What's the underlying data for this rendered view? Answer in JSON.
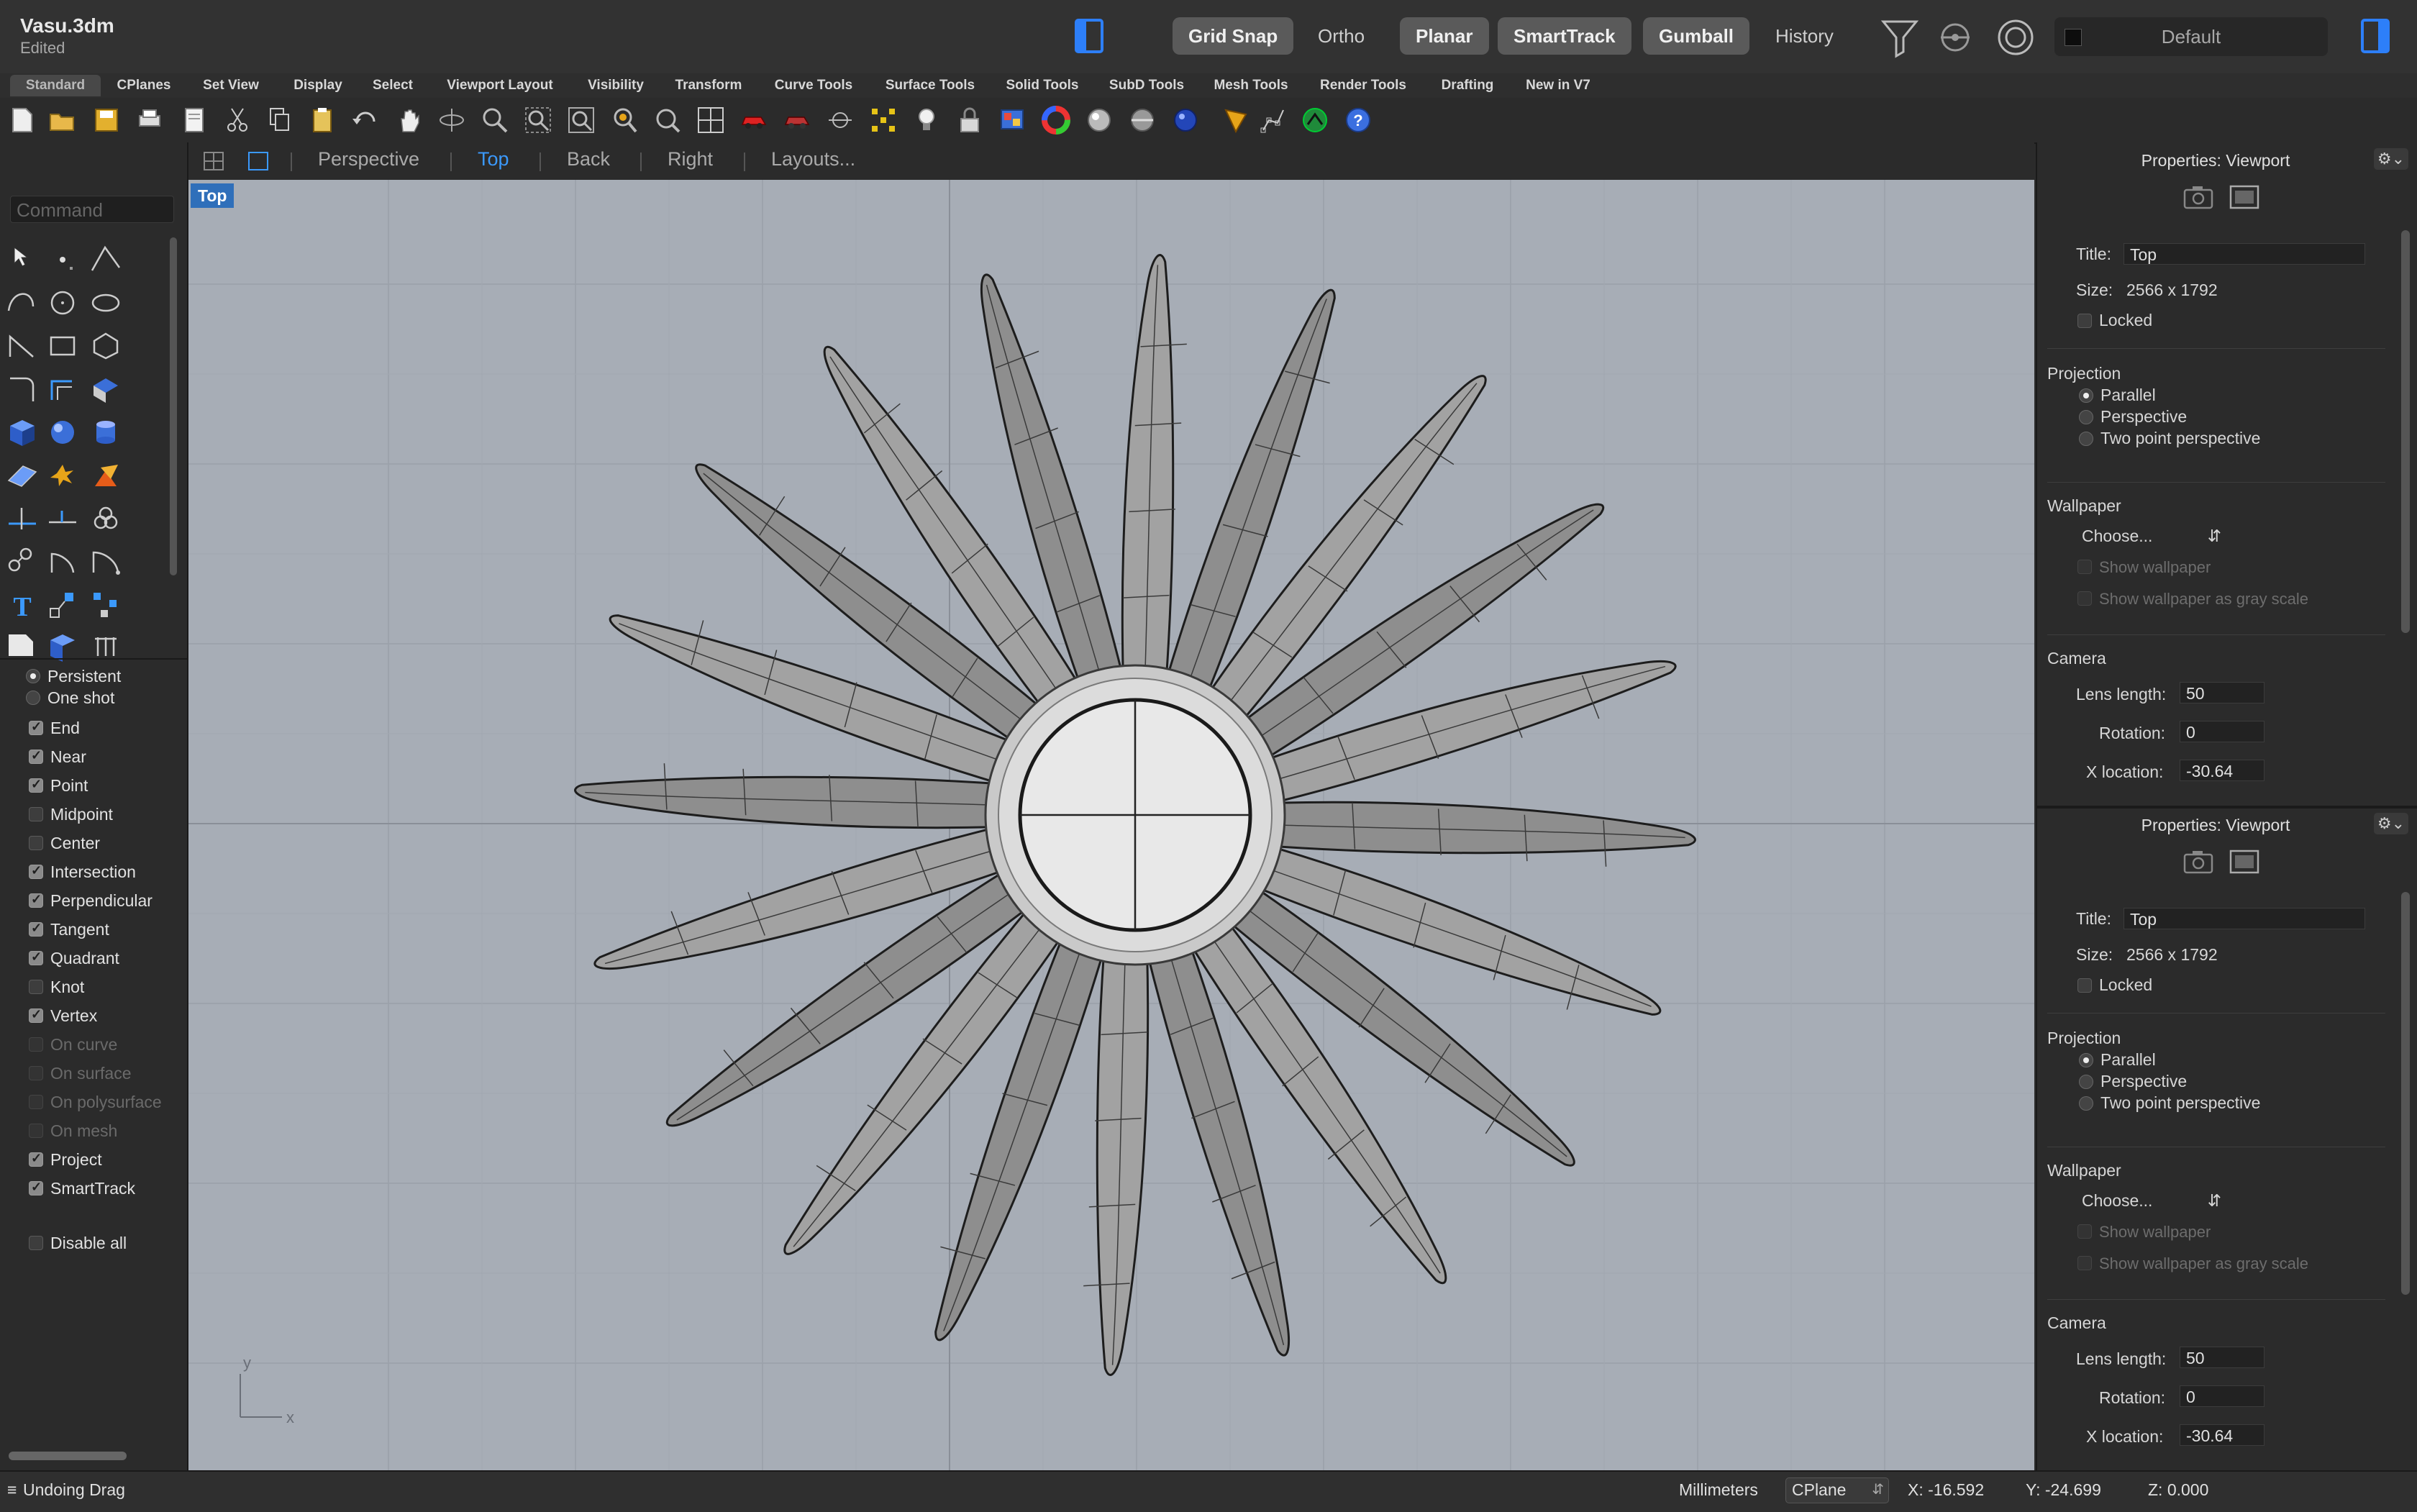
{
  "window": {
    "title": "Vasu.3dm",
    "status": "Edited"
  },
  "titlebar": {
    "buttons": [
      {
        "label": "Grid Snap",
        "active": true
      },
      {
        "label": "Ortho",
        "active": false
      },
      {
        "label": "Planar",
        "active": true
      },
      {
        "label": "SmartTrack",
        "active": true
      },
      {
        "label": "Gumball",
        "active": true
      },
      {
        "label": "History",
        "active": false
      }
    ],
    "layer": "Default",
    "icons": [
      "left-panel-toggle-icon",
      "filter-icon",
      "record-icon",
      "target-icon",
      "right-panel-toggle-icon"
    ]
  },
  "tabs": [
    "Standard",
    "CPlanes",
    "Set View",
    "Display",
    "Select",
    "Viewport Layout",
    "Visibility",
    "Transform",
    "Curve Tools",
    "Surface Tools",
    "Solid Tools",
    "SubD Tools",
    "Mesh Tools",
    "Render Tools",
    "Drafting",
    "New in V7"
  ],
  "active_tab": "Standard",
  "viewport_tabs": {
    "items": [
      "Perspective",
      "Top",
      "Back",
      "Right",
      "Layouts..."
    ],
    "active": "Top"
  },
  "viewport": {
    "label": "Top",
    "axis_x": "x",
    "axis_y": "y"
  },
  "command": {
    "placeholder": "Command"
  },
  "osnap": {
    "modes": [
      {
        "label": "Persistent",
        "selected": true
      },
      {
        "label": "One shot",
        "selected": false
      }
    ],
    "items": [
      {
        "label": "End",
        "checked": true,
        "enabled": true
      },
      {
        "label": "Near",
        "checked": true,
        "enabled": true
      },
      {
        "label": "Point",
        "checked": true,
        "enabled": true
      },
      {
        "label": "Midpoint",
        "checked": false,
        "enabled": true
      },
      {
        "label": "Center",
        "checked": false,
        "enabled": true
      },
      {
        "label": "Intersection",
        "checked": true,
        "enabled": true
      },
      {
        "label": "Perpendicular",
        "checked": true,
        "enabled": true
      },
      {
        "label": "Tangent",
        "checked": true,
        "enabled": true
      },
      {
        "label": "Quadrant",
        "checked": true,
        "enabled": true
      },
      {
        "label": "Knot",
        "checked": false,
        "enabled": true
      },
      {
        "label": "Vertex",
        "checked": true,
        "enabled": true
      },
      {
        "label": "On curve",
        "checked": false,
        "enabled": false
      },
      {
        "label": "On surface",
        "checked": false,
        "enabled": false
      },
      {
        "label": "On polysurface",
        "checked": false,
        "enabled": false
      },
      {
        "label": "On mesh",
        "checked": false,
        "enabled": false
      },
      {
        "label": "Project",
        "checked": true,
        "enabled": true
      },
      {
        "label": "SmartTrack",
        "checked": true,
        "enabled": true
      }
    ],
    "disable_all": "Disable all"
  },
  "properties": [
    {
      "title": "Properties: Viewport",
      "title_label": "Title:",
      "title_value": "Top",
      "size_label": "Size:",
      "size_value": "2566 x 1792",
      "locked": "Locked",
      "projection_label": "Projection",
      "projections": [
        {
          "label": "Parallel",
          "selected": true
        },
        {
          "label": "Perspective",
          "selected": false
        },
        {
          "label": "Two point perspective",
          "selected": false
        }
      ],
      "wallpaper_label": "Wallpaper",
      "wallpaper_choose": "Choose...",
      "show_wallpaper": "Show wallpaper",
      "show_gray": "Show wallpaper as gray scale",
      "camera_label": "Camera",
      "lens_label": "Lens length:",
      "lens_value": "50",
      "rotation_label": "Rotation:",
      "rotation_value": "0",
      "xloc_label": "X location:",
      "xloc_value": "-30.64"
    },
    {
      "title": "Properties: Viewport",
      "title_label": "Title:",
      "title_value": "Top",
      "size_label": "Size:",
      "size_value": "2566 x 1792",
      "locked": "Locked",
      "projection_label": "Projection",
      "projections": [
        {
          "label": "Parallel",
          "selected": true
        },
        {
          "label": "Perspective",
          "selected": false
        },
        {
          "label": "Two point perspective",
          "selected": false
        }
      ],
      "wallpaper_label": "Wallpaper",
      "wallpaper_choose": "Choose...",
      "show_wallpaper": "Show wallpaper",
      "show_gray": "Show wallpaper as gray scale",
      "camera_label": "Camera",
      "lens_label": "Lens length:",
      "lens_value": "50",
      "rotation_label": "Rotation:",
      "rotation_value": "0",
      "xloc_label": "X location:",
      "xloc_value": "-30.64"
    }
  ],
  "statusbar": {
    "message": "Undoing Drag",
    "units": "Millimeters",
    "cplane": "CPlane",
    "x": "X: -16.592",
    "y": "Y: -24.699",
    "z": "Z: 0.000"
  },
  "colors": {
    "accent": "#2d7ff9",
    "viewport_bg": "#a7adb6",
    "active_view": "#3b99fc"
  }
}
